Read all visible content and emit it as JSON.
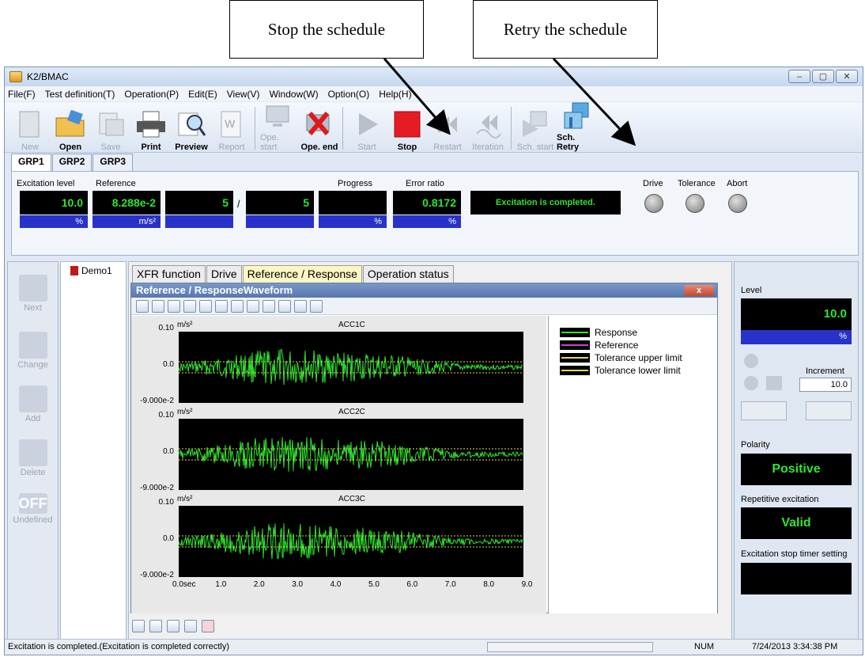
{
  "callouts": {
    "stop": "Stop the schedule",
    "retry": "Retry the schedule"
  },
  "window": {
    "title": "K2/BMAC",
    "buttons": [
      "–",
      "▢",
      "✕"
    ]
  },
  "menu": [
    "File(F)",
    "Test definition(T)",
    "Operation(P)",
    "Edit(E)",
    "View(V)",
    "Window(W)",
    "Option(O)",
    "Help(H)"
  ],
  "toolbar": [
    {
      "label": "New",
      "enabled": false
    },
    {
      "label": "Open",
      "enabled": true
    },
    {
      "label": "Save",
      "enabled": false
    },
    {
      "label": "Print",
      "enabled": true
    },
    {
      "label": "Preview",
      "enabled": true
    },
    {
      "label": "Report",
      "enabled": false
    },
    {
      "label": "Ope. start",
      "enabled": false
    },
    {
      "label": "Ope. end",
      "enabled": true
    },
    {
      "label": "Start",
      "enabled": false
    },
    {
      "label": "Stop",
      "enabled": true
    },
    {
      "label": "Restart",
      "enabled": false
    },
    {
      "label": "Iteration",
      "enabled": false
    },
    {
      "label": "Sch. start",
      "enabled": false
    },
    {
      "label": "Sch. Retry",
      "enabled": true
    }
  ],
  "groups": [
    "GRP1",
    "GRP2",
    "GRP3"
  ],
  "status": {
    "excitation_level_label": "Excitation level",
    "excitation_level": "10.0",
    "excitation_unit": "%",
    "reference_label": "Reference",
    "reference": "8.288e-2",
    "reference_unit": "m/s²",
    "count_a": "5",
    "slash": "/",
    "count_b": "5",
    "progress_label": "Progress",
    "progress_unit": "%",
    "error_ratio_label": "Error ratio",
    "error_ratio": "0.8172",
    "error_unit": "%",
    "message": "Excitation is completed.",
    "lamps": [
      "Drive",
      "Tolerance",
      "Abort"
    ]
  },
  "left_actions": [
    "Next",
    "Change",
    "Add",
    "Delete",
    "Undefined"
  ],
  "off_badge": "OFF",
  "tree": {
    "item": "Demo1"
  },
  "tabs": [
    "XFR function",
    "Drive",
    "Reference / Response",
    "Operation status"
  ],
  "subwindow": {
    "title": "Reference / ResponseWaveform",
    "close": "x"
  },
  "plots": [
    {
      "title": "ACC1C",
      "y_top": "0.10",
      "unit": "m/s²",
      "y_mid": "0.0",
      "y_bottom": "-9.000e-2"
    },
    {
      "title": "ACC2C",
      "y_top": "0.10",
      "unit": "m/s²",
      "y_mid": "0.0",
      "y_bottom": "-9.000e-2"
    },
    {
      "title": "ACC3C",
      "y_top": "0.10",
      "unit": "m/s²",
      "y_mid": "0.0",
      "y_bottom": "-9.000e-2"
    }
  ],
  "x_ticks": [
    "0.0sec",
    "1.0",
    "2.0",
    "3.0",
    "4.0",
    "5.0",
    "6.0",
    "7.0",
    "8.0",
    "9.0"
  ],
  "legend": [
    {
      "name": "Response",
      "color": "#2ee62e"
    },
    {
      "name": "Reference",
      "color": "#d040d0"
    },
    {
      "name": "Tolerance upper limit",
      "color": "#e8d84a"
    },
    {
      "name": "Tolerance lower limit",
      "color": "#e8d84a"
    }
  ],
  "right": {
    "level_label": "Level",
    "level": "10.0",
    "level_unit": "%",
    "increment_label": "Increment",
    "increment": "10.0",
    "polarity_label": "Polarity",
    "polarity": "Positive",
    "repetitive_label": "Repetitive excitation",
    "repetitive": "Valid",
    "timer_label": "Excitation stop timer setting"
  },
  "statusbar": {
    "message": "Excitation is completed.(Excitation is completed correctly)",
    "num": "NUM",
    "datetime": "7/24/2013  3:34:38 PM"
  }
}
